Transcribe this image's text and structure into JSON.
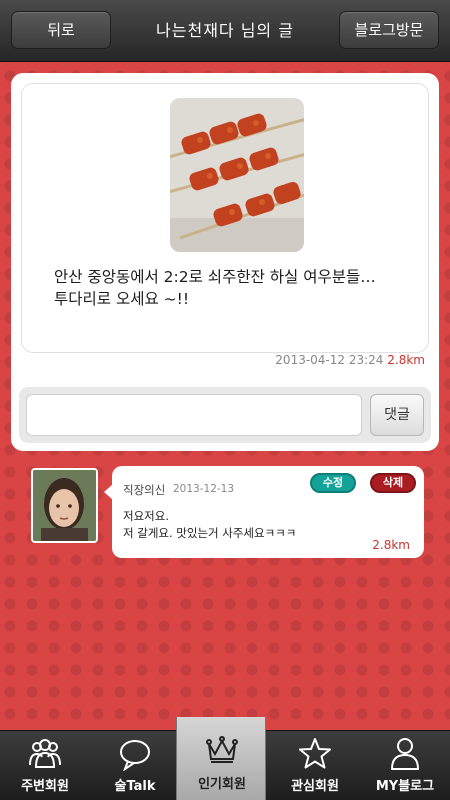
{
  "header": {
    "back_label": "뒤로",
    "title": "나는천재다 님의 글",
    "visit_label": "블로그방문"
  },
  "post": {
    "text_lines": [
      "안산 중앙동에서 2:2로 쇠주한잔 하실 여우분들…",
      "투다리로 오세요 ~!!"
    ],
    "timestamp": "2013-04-12 23:24",
    "distance": "2.8km"
  },
  "comment_form": {
    "placeholder": "",
    "button_label": "댓글"
  },
  "comments": [
    {
      "author": "직장의신",
      "date": "2013-12-13",
      "edit_label": "수정",
      "delete_label": "삭제",
      "lines": [
        "저요저요.",
        "저 갈게요. 맛있는거 사주세요ㅋㅋㅋ"
      ],
      "distance": "2.8km"
    }
  ],
  "tabbar": {
    "active": 2,
    "tabs": [
      {
        "label": "주변회원",
        "icon": "people-icon"
      },
      {
        "label": "술Talk",
        "icon": "speech-bubble-icon"
      },
      {
        "label": "인기회원",
        "icon": "crown-icon"
      },
      {
        "label": "관심회원",
        "icon": "star-icon"
      },
      {
        "label": "MY블로그",
        "icon": "person-icon"
      }
    ]
  },
  "colors": {
    "background": "#d94545",
    "accent_red": "#c8342c",
    "edit_badge": "#13a398",
    "delete_badge": "#a91d23"
  }
}
